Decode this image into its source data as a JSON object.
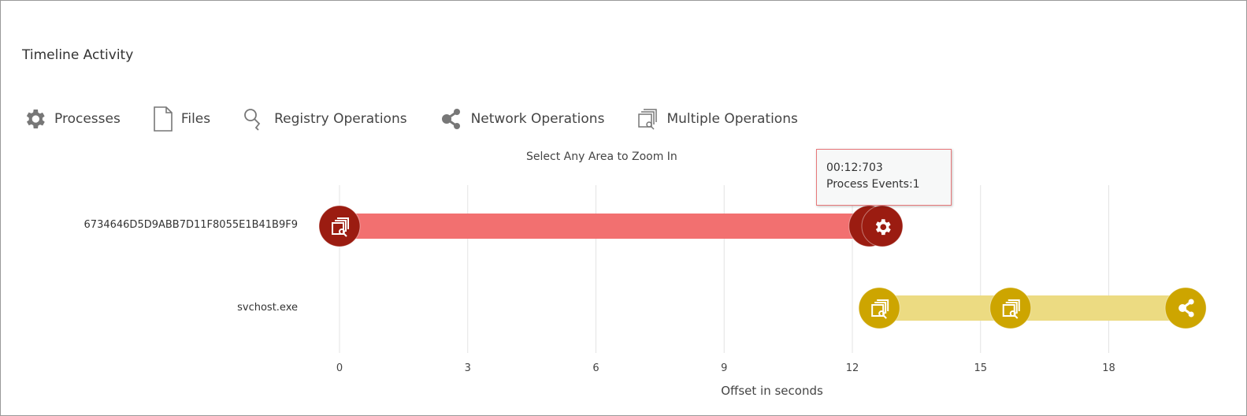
{
  "title": "Timeline Activity",
  "legend": [
    {
      "label": "Processes",
      "icon": "gear-icon"
    },
    {
      "label": "Files",
      "icon": "file-icon"
    },
    {
      "label": "Registry Operations",
      "icon": "key-icon"
    },
    {
      "label": "Network Operations",
      "icon": "share-icon"
    },
    {
      "label": "Multiple Operations",
      "icon": "multiple-operations-icon"
    }
  ],
  "zoom_hint": "Select Any Area to Zoom In",
  "tooltip": {
    "time": "00:12:703",
    "text": "Process Events:1"
  },
  "chart_data": {
    "type": "timeline",
    "xlabel": "Offset in seconds",
    "xlim": [
      0,
      20.4
    ],
    "xticks": [
      "0",
      "3",
      "6",
      "9",
      "12",
      "15",
      "18"
    ],
    "grid": true,
    "rows": [
      {
        "label": "6734646D5D9ABB7D11F8055E1B41B9F9",
        "bar_color": "#f27070",
        "icon_color": "#9b1c11",
        "span": [
          0,
          12.7
        ],
        "events": [
          {
            "t": 0,
            "icon": "multiple-operations-icon"
          },
          {
            "t": 12.4,
            "icon": "gear-icon"
          },
          {
            "t": 12.7,
            "icon": "gear-icon"
          }
        ]
      },
      {
        "label": "svchost.exe",
        "bar_color": "#ecdb82",
        "icon_color": "#cda500",
        "span": [
          12.63,
          19.8
        ],
        "events": [
          {
            "t": 12.63,
            "icon": "multiple-operations-icon"
          },
          {
            "t": 15.7,
            "icon": "multiple-operations-icon"
          },
          {
            "t": 19.8,
            "icon": "share-icon"
          }
        ]
      }
    ]
  }
}
